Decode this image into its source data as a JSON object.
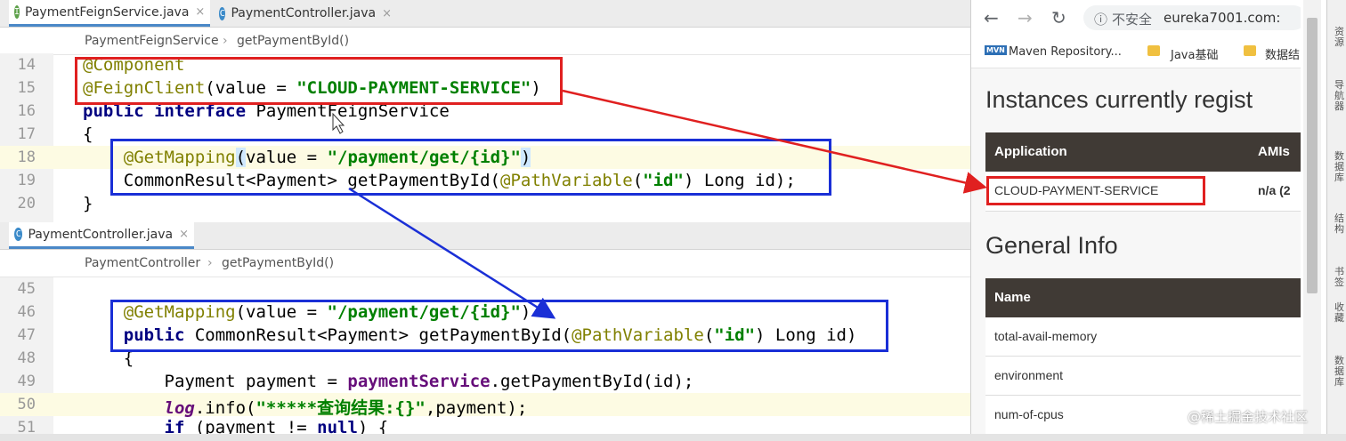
{
  "ide": {
    "top_tabs": [
      {
        "icon": "I",
        "label": "PaymentFeignService.java",
        "close": "×"
      },
      {
        "icon": "C",
        "label": "PaymentController.java",
        "close": "×"
      }
    ],
    "top_breadcrumb": [
      "PaymentFeignService",
      "getPaymentById()"
    ],
    "top_lines": [
      {
        "n": "14",
        "parts": [
          {
            "t": "@Component",
            "c": "ann"
          }
        ]
      },
      {
        "n": "15",
        "parts": [
          {
            "t": "@FeignClient",
            "c": "ann"
          },
          {
            "t": "(value = ",
            "c": ""
          },
          {
            "t": "\"CLOUD-PAYMENT-SERVICE\"",
            "c": "str"
          },
          {
            "t": ")",
            "c": ""
          }
        ]
      },
      {
        "n": "16",
        "parts": [
          {
            "t": "public interface ",
            "c": "kw"
          },
          {
            "t": "PaymentFeignService",
            "c": ""
          }
        ]
      },
      {
        "n": "17",
        "parts": [
          {
            "t": "{",
            "c": ""
          }
        ]
      },
      {
        "n": "18",
        "parts": [
          {
            "t": "    @GetMapping",
            "c": "ann"
          },
          {
            "t": "(",
            "c": "brace"
          },
          {
            "t": "value = ",
            "c": ""
          },
          {
            "t": "\"/payment/get/{id}\"",
            "c": "str"
          },
          {
            "t": ")",
            "c": "brace"
          }
        ],
        "hl": true
      },
      {
        "n": "19",
        "parts": [
          {
            "t": "    CommonResult<Payment> getPaymentById(",
            "c": ""
          },
          {
            "t": "@PathVariable",
            "c": "ann"
          },
          {
            "t": "(",
            "c": ""
          },
          {
            "t": "\"id\"",
            "c": "str"
          },
          {
            "t": ") Long id);",
            "c": ""
          }
        ]
      },
      {
        "n": "20",
        "parts": [
          {
            "t": "}",
            "c": ""
          }
        ]
      }
    ],
    "bottom_tab": {
      "icon": "C",
      "label": "PaymentController.java",
      "close": "×"
    },
    "bottom_breadcrumb": [
      "PaymentController",
      "getPaymentById()"
    ],
    "bottom_lines": [
      {
        "n": "45",
        "parts": []
      },
      {
        "n": "46",
        "parts": [
          {
            "t": "    @GetMapping",
            "c": "ann"
          },
          {
            "t": "(value = ",
            "c": ""
          },
          {
            "t": "\"/payment/get/{id}\"",
            "c": "str"
          },
          {
            "t": ")",
            "c": ""
          }
        ]
      },
      {
        "n": "47",
        "parts": [
          {
            "t": "    public ",
            "c": "kw"
          },
          {
            "t": "CommonResult<Payment> getPaymentById(",
            "c": ""
          },
          {
            "t": "@PathVariable",
            "c": "ann"
          },
          {
            "t": "(",
            "c": ""
          },
          {
            "t": "\"id\"",
            "c": "str"
          },
          {
            "t": ") Long id)",
            "c": ""
          }
        ]
      },
      {
        "n": "48",
        "parts": [
          {
            "t": "    {",
            "c": ""
          }
        ]
      },
      {
        "n": "49",
        "parts": [
          {
            "t": "        Payment payment = ",
            "c": ""
          },
          {
            "t": "paymentService",
            "c": "fld"
          },
          {
            "t": ".getPaymentById(id);",
            "c": ""
          }
        ]
      },
      {
        "n": "50",
        "parts": [
          {
            "t": "        ",
            "c": ""
          },
          {
            "t": "log",
            "c": "log"
          },
          {
            "t": ".info(",
            "c": ""
          },
          {
            "t": "\"*****查询结果:{}\"",
            "c": "str"
          },
          {
            "t": ",payment);",
            "c": ""
          }
        ],
        "hl": true
      },
      {
        "n": "51",
        "parts": [
          {
            "t": "        ",
            "c": ""
          },
          {
            "t": "if",
            "c": "kw"
          },
          {
            "t": " (payment != ",
            "c": ""
          },
          {
            "t": "null",
            "c": "kw"
          },
          {
            "t": ") {",
            "c": ""
          }
        ]
      }
    ]
  },
  "browser": {
    "back_icon": "←",
    "forward_icon": "→",
    "reload_icon": "↻",
    "info_icon": "ⓘ",
    "insecure_label": "不安全",
    "url": "eureka7001.com:",
    "bookmarks": [
      {
        "icon": "MVN",
        "label": "Maven Repository..."
      },
      {
        "icon": "folder",
        "label": "Java基础"
      },
      {
        "icon": "folder",
        "label": "数据结"
      }
    ],
    "instances_heading": "Instances currently regist",
    "instances_table": {
      "headers": [
        "Application",
        "AMIs"
      ],
      "rows": [
        [
          "CLOUD-PAYMENT-SERVICE",
          "n/a (2"
        ]
      ]
    },
    "general_heading": "General Info",
    "general_table": {
      "header": "Name",
      "rows": [
        "total-avail-memory",
        "environment",
        "num-of-cpus"
      ]
    }
  },
  "sidebar": {
    "items": [
      "资源",
      "导航器",
      "数据库",
      "结构",
      "书签",
      "收藏",
      "数据库"
    ]
  },
  "watermark": "@稀土掘金技术社区",
  "colors": {
    "red_box": "#e02020",
    "blue_box": "#1a2fd6",
    "annotation": "#808000",
    "string": "#008000",
    "keyword": "#000080",
    "table_header": "#403a35"
  }
}
